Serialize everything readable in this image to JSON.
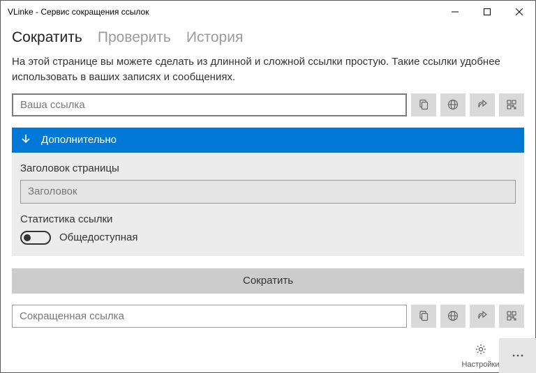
{
  "window": {
    "title": "VLinke - Сервис сокращения ссылок"
  },
  "tabs": {
    "shorten": "Сократить",
    "check": "Проверить",
    "history": "История"
  },
  "description": "На этой странице вы можете сделать из длинной и сложной ссылки простую. Такие ссылки удобнее использовать в ваших записях и сообщениях.",
  "url_input": {
    "placeholder": "Ваша ссылка"
  },
  "accordion": {
    "header": "Дополнительно",
    "page_title_label": "Заголовок страницы",
    "page_title_placeholder": "Заголовок",
    "stats_label": "Статистика ссылки",
    "toggle_label": "Общедоступная"
  },
  "submit": "Сократить",
  "result_input": {
    "placeholder": "Сокращенная ссылка"
  },
  "footer": {
    "settings": "Настройки"
  }
}
